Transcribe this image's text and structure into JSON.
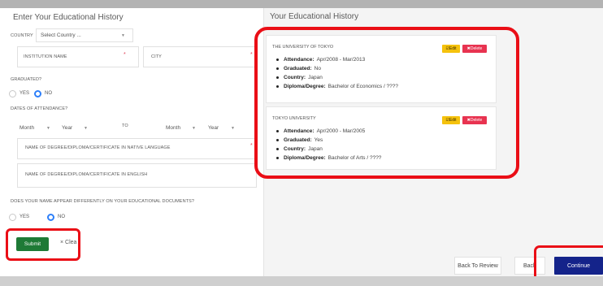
{
  "left": {
    "title": "Enter Your Educational History",
    "country_label": "COUNTRY",
    "country_select": "Select Country ...",
    "institution_label": "INSTITUTION NAME",
    "city_label": "CITY",
    "required_mark": "*",
    "graduated_label": "GRADUATED?",
    "yes": "YES",
    "no": "NO",
    "dates_label": "DATES OF ATTENDANCE?",
    "month": "Month",
    "year": "Year",
    "to": "TO",
    "degree_native_label": "NAME OF DEGREE/DIPLOMA/CERTIFICATE IN NATIVE LANGUAGE",
    "degree_english_label": "NAME OF DEGREE/DIPLOMA/CERTIFICATE IN ENGLISH",
    "name_diff_label": "DOES YOUR NAME APPEAR DIFFERENTLY ON YOUR EDUCATIONAL DOCUMENTS?",
    "submit": "Submit",
    "clear": "× Clea"
  },
  "right": {
    "title": "Your Educational History",
    "cards": [
      {
        "institution": "THE UNIVERSITY OF TOKYO",
        "edit": "☑Edit",
        "delete": "✖Delete",
        "items": [
          {
            "label": "Attendance:",
            "value": "Apr/2008 - Mar/2013"
          },
          {
            "label": "Graduated:",
            "value": "No"
          },
          {
            "label": "Country:",
            "value": "Japan"
          },
          {
            "label": "Diploma/Degree:",
            "value": "Bachelor of Economics  /  ????"
          }
        ]
      },
      {
        "institution": "TOKYO UNIVERSITY",
        "edit": "☑Edit",
        "delete": "✖Delete",
        "items": [
          {
            "label": "Attendance:",
            "value": "Apr/2000 - Mar/2005"
          },
          {
            "label": "Graduated:",
            "value": "Yes"
          },
          {
            "label": "Country:",
            "value": "Japan"
          },
          {
            "label": "Diploma/Degree:",
            "value": "Bachelor of Arts  /  ????"
          }
        ]
      }
    ],
    "back_to_review": "Back To Review",
    "back": "Back",
    "continue": "Continue"
  },
  "colors": {
    "highlight": "#ea0e16",
    "submit": "#1e7a36",
    "continue": "#14238a",
    "edit": "#f5c20d",
    "delete": "#e83350",
    "radio_selected": "#2d7ff9"
  }
}
